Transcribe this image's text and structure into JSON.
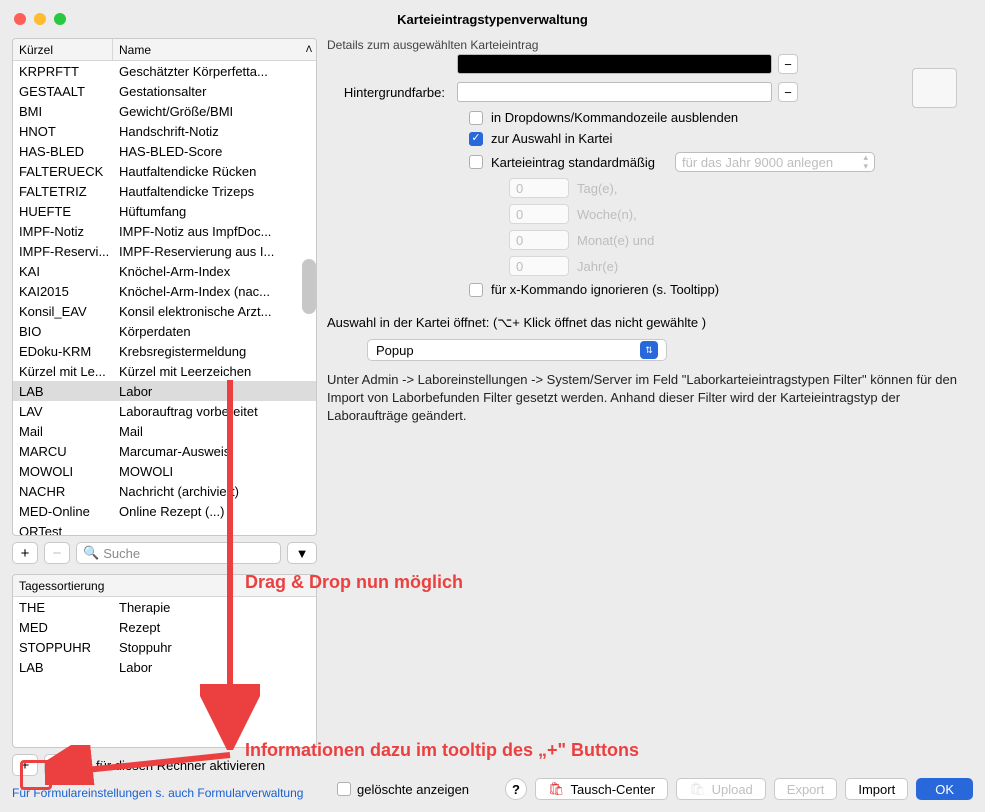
{
  "window": {
    "title": "Karteieintragstypenverwaltung"
  },
  "list": {
    "col1": "Kürzel",
    "col2": "Name",
    "rows": [
      {
        "k": "KRPRFTT",
        "n": "Geschätzter Körperfetta..."
      },
      {
        "k": "GESTAALT",
        "n": "Gestationsalter"
      },
      {
        "k": "BMI",
        "n": "Gewicht/Größe/BMI"
      },
      {
        "k": "HNOT",
        "n": "Handschrift-Notiz"
      },
      {
        "k": "HAS-BLED",
        "n": "HAS-BLED-Score"
      },
      {
        "k": "FALTERUECK",
        "n": "Hautfaltendicke Rücken"
      },
      {
        "k": "FALTETRIZ",
        "n": "Hautfaltendicke Trizeps"
      },
      {
        "k": "HUEFTE",
        "n": "Hüftumfang"
      },
      {
        "k": "IMPF-Notiz",
        "n": "IMPF-Notiz aus ImpfDoc..."
      },
      {
        "k": "IMPF-Reservi...",
        "n": "IMPF-Reservierung aus I..."
      },
      {
        "k": "KAI",
        "n": "Knöchel-Arm-Index"
      },
      {
        "k": "KAI2015",
        "n": "Knöchel-Arm-Index (nac..."
      },
      {
        "k": "Konsil_EAV",
        "n": "Konsil elektronische Arzt..."
      },
      {
        "k": "BIO",
        "n": "Körperdaten"
      },
      {
        "k": "EDoku-KRM",
        "n": "Krebsregistermeldung"
      },
      {
        "k": "Kürzel mit Le...",
        "n": "Kürzel mit Leerzeichen"
      },
      {
        "k": "LAB",
        "n": "Labor",
        "sel": true
      },
      {
        "k": "LAV",
        "n": "Laborauftrag vorbereitet"
      },
      {
        "k": "Mail",
        "n": "Mail"
      },
      {
        "k": "MARCU",
        "n": "Marcumar-Ausweis"
      },
      {
        "k": "MOWOLI",
        "n": "MOWOLI"
      },
      {
        "k": "NACHR",
        "n": "Nachricht (archiviert)"
      },
      {
        "k": "MED-Online",
        "n": "Online Rezept (...)"
      },
      {
        "k": "ORTest",
        "n": ""
      }
    ],
    "search_placeholder": "Suche"
  },
  "sort": {
    "header": "Tagessortierung",
    "rows": [
      {
        "k": "THE",
        "n": "Therapie"
      },
      {
        "k": "MED",
        "n": "Rezept"
      },
      {
        "k": "STOPPUHR",
        "n": "Stoppuhr"
      },
      {
        "k": "LAB",
        "n": "Labor"
      }
    ],
    "activate": "für diesen Rechner aktivieren"
  },
  "link": "Für Formulareinstellungen s. auch Formularverwaltung",
  "details": {
    "section": "Details zum ausgewählten Karteieintrag",
    "bgcolor": "Hintergrundfarbe:",
    "hide": "in Dropdowns/Kommandozeile ausblenden",
    "selectKartei": "zur Auswahl in Kartei",
    "standard": "Karteieintrag standardmäßig",
    "yearSelect": "für das Jahr 9000 anlegen",
    "tag": "Tag(e),",
    "woche": "Woche(n),",
    "monat": "Monat(e) und",
    "jahr": "Jahr(e)",
    "num": "0",
    "ignore": "für x-Kommando ignorieren (s. Tooltipp)",
    "opens": "Auswahl in der Kartei öffnet: (⌥+ Klick öffnet das nicht gewählte )",
    "popup": "Popup",
    "info": "Unter Admin -> Laboreinstellungen -> System/Server im Feld \"Laborkarteieintragstypen Filter\" können für den Import von Laborbefunden Filter gesetzt werden. Anhand dieser Filter wird der Karteieintragstyp der Laboraufträge geändert."
  },
  "footer": {
    "deleted": "gelöschte anzeigen",
    "tausch": "Tausch-Center",
    "upload": "Upload",
    "export": "Export",
    "import": "Import",
    "ok": "OK"
  },
  "anno": {
    "drag": "Drag & Drop nun möglich",
    "tooltip": "Informationen dazu im tooltip des „+\" Buttons"
  }
}
